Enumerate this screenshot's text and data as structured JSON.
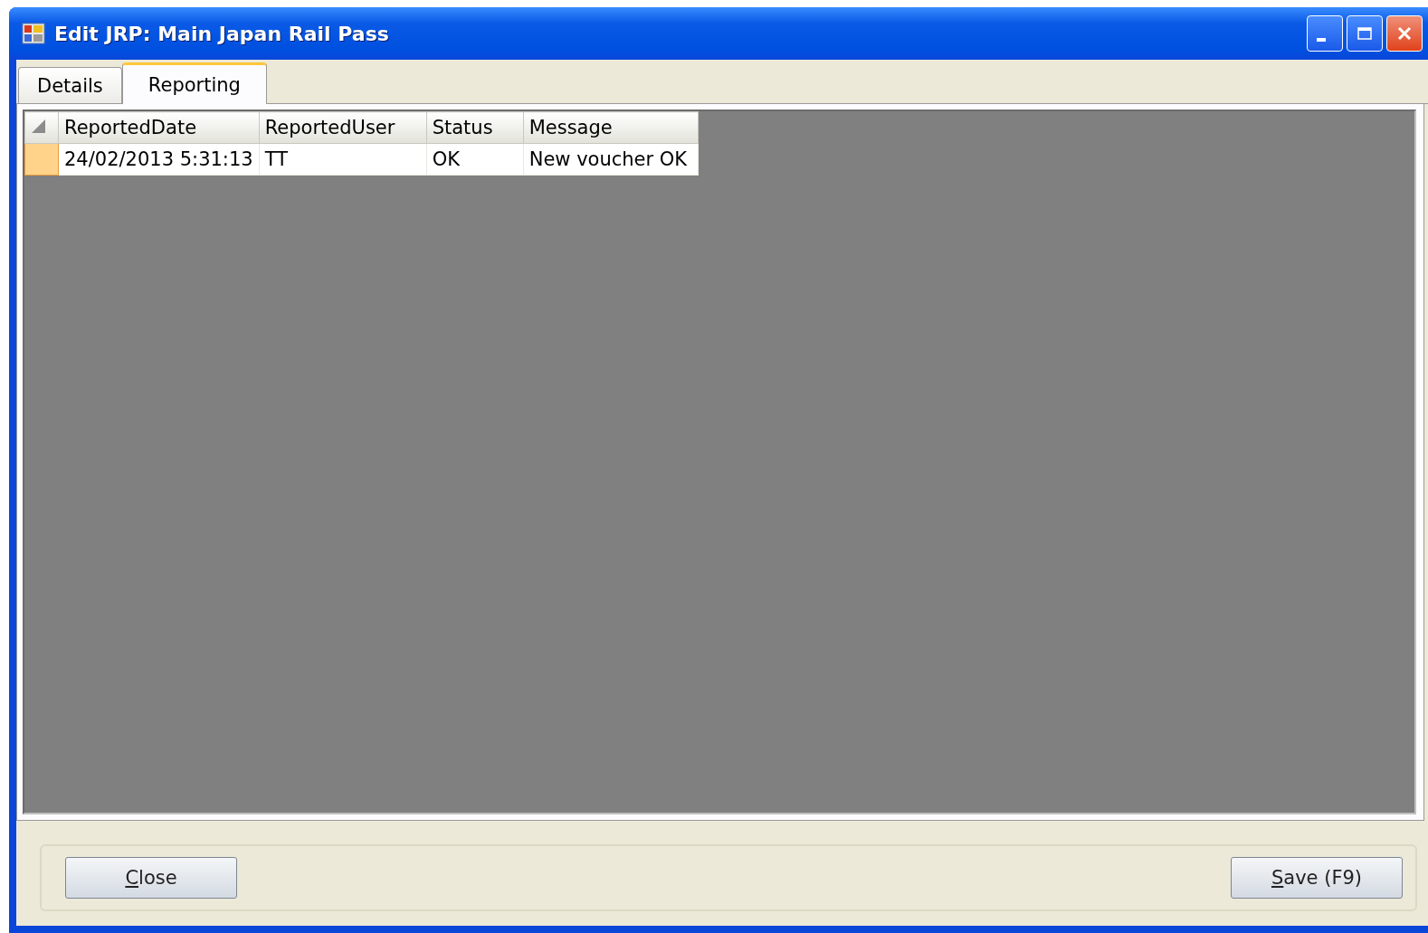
{
  "window": {
    "title": "Edit JRP: Main Japan Rail Pass"
  },
  "tabs": [
    {
      "label": "Details",
      "selected": false
    },
    {
      "label": "Reporting",
      "selected": true
    }
  ],
  "table": {
    "columns": [
      "ReportedDate",
      "ReportedUser",
      "Status",
      "Message"
    ],
    "rows": [
      {
        "cells": [
          "24/02/2013 5:31:13",
          "TT",
          "OK",
          "New voucher OK"
        ],
        "selected": true
      }
    ]
  },
  "buttons": [
    {
      "label": "Close",
      "underline_first": true
    },
    {
      "label": "Save (F9)",
      "underline_first": true
    }
  ]
}
